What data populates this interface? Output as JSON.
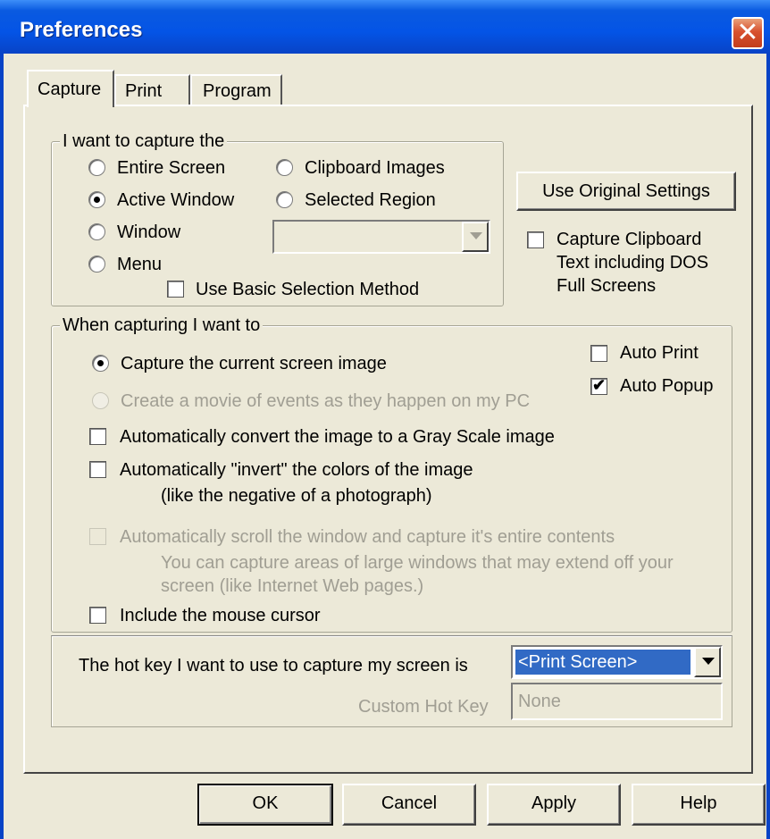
{
  "window": {
    "title": "Preferences",
    "close_icon": "close-icon"
  },
  "tabs": [
    {
      "label": "Capture",
      "selected": true
    },
    {
      "label": "Print",
      "selected": false
    },
    {
      "label": "Program",
      "selected": false
    }
  ],
  "capture_group": {
    "legend": "I want to capture the",
    "options": [
      {
        "label": "Entire Screen",
        "selected": false
      },
      {
        "label": "Active Window",
        "selected": true
      },
      {
        "label": "Window",
        "selected": false
      },
      {
        "label": "Menu",
        "selected": false
      },
      {
        "label": "Clipboard Images",
        "selected": false
      },
      {
        "label": "Selected Region",
        "selected": false
      }
    ],
    "region_select_value": "",
    "basic_selection": {
      "label": "Use Basic Selection Method",
      "checked": false
    }
  },
  "side": {
    "original_settings_button": "Use Original Settings",
    "clipboard_text": {
      "line1": "Capture Clipboard",
      "line2": "Text including DOS",
      "line3": "Full Screens",
      "checked": false
    }
  },
  "when_group": {
    "legend": "When capturing I want to",
    "capture_screen": {
      "label": "Capture the current screen image",
      "selected": true
    },
    "create_movie": {
      "label": "Create a movie of events as they happen on my PC",
      "selected": false,
      "enabled": false
    },
    "auto_print": {
      "label": "Auto Print",
      "checked": false
    },
    "auto_popup": {
      "label": "Auto Popup",
      "checked": true
    },
    "gray_scale": {
      "label": "Automatically convert the image to a Gray Scale image",
      "checked": false
    },
    "invert": {
      "label": "Automatically \"invert\" the colors of the image",
      "sub": "(like the negative of a photograph)",
      "checked": false
    },
    "auto_scroll": {
      "label": "Automatically scroll the window and capture it's entire contents",
      "sub1": "You can capture areas of large windows that may extend off your",
      "sub2": "screen (like Internet Web pages.)",
      "checked": false,
      "enabled": false
    },
    "mouse_cursor": {
      "label": "Include the mouse cursor",
      "checked": false
    }
  },
  "hotkey": {
    "label": "The hot key I want to use to capture my screen is",
    "value": "<Print Screen>",
    "custom_label": "Custom Hot Key",
    "custom_value": "None"
  },
  "buttons": {
    "ok": "OK",
    "cancel": "Cancel",
    "apply": "Apply",
    "help": "Help"
  },
  "colors": {
    "titlebar": "#0454e6",
    "selection": "#316ac5",
    "face": "#ece9d8"
  }
}
